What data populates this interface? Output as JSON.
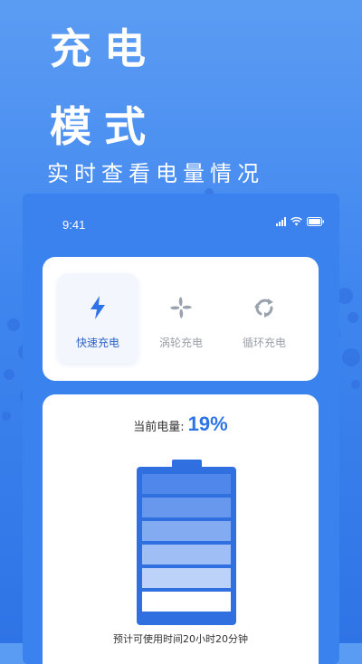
{
  "promo": {
    "line1": "充电",
    "line2": "模式",
    "subtitle": "实时查看电量情况"
  },
  "status_bar": {
    "time": "9:41",
    "icons": [
      "signal-icon",
      "wifi-icon",
      "battery-icon"
    ]
  },
  "modes": [
    {
      "label": "快速充电",
      "icon": "lightning-icon",
      "selected": true
    },
    {
      "label": "涡轮充电",
      "icon": "fan-icon",
      "selected": false
    },
    {
      "label": "循环充电",
      "icon": "recycle-icon",
      "selected": false
    }
  ],
  "battery": {
    "label": "当前电量:",
    "value": "19%",
    "estimate": "预计可使用时间20小时20分钟"
  },
  "colors": {
    "accent": "#2f74e6",
    "background_top": "#5b9cf3",
    "background_bottom": "#2f74e6"
  }
}
